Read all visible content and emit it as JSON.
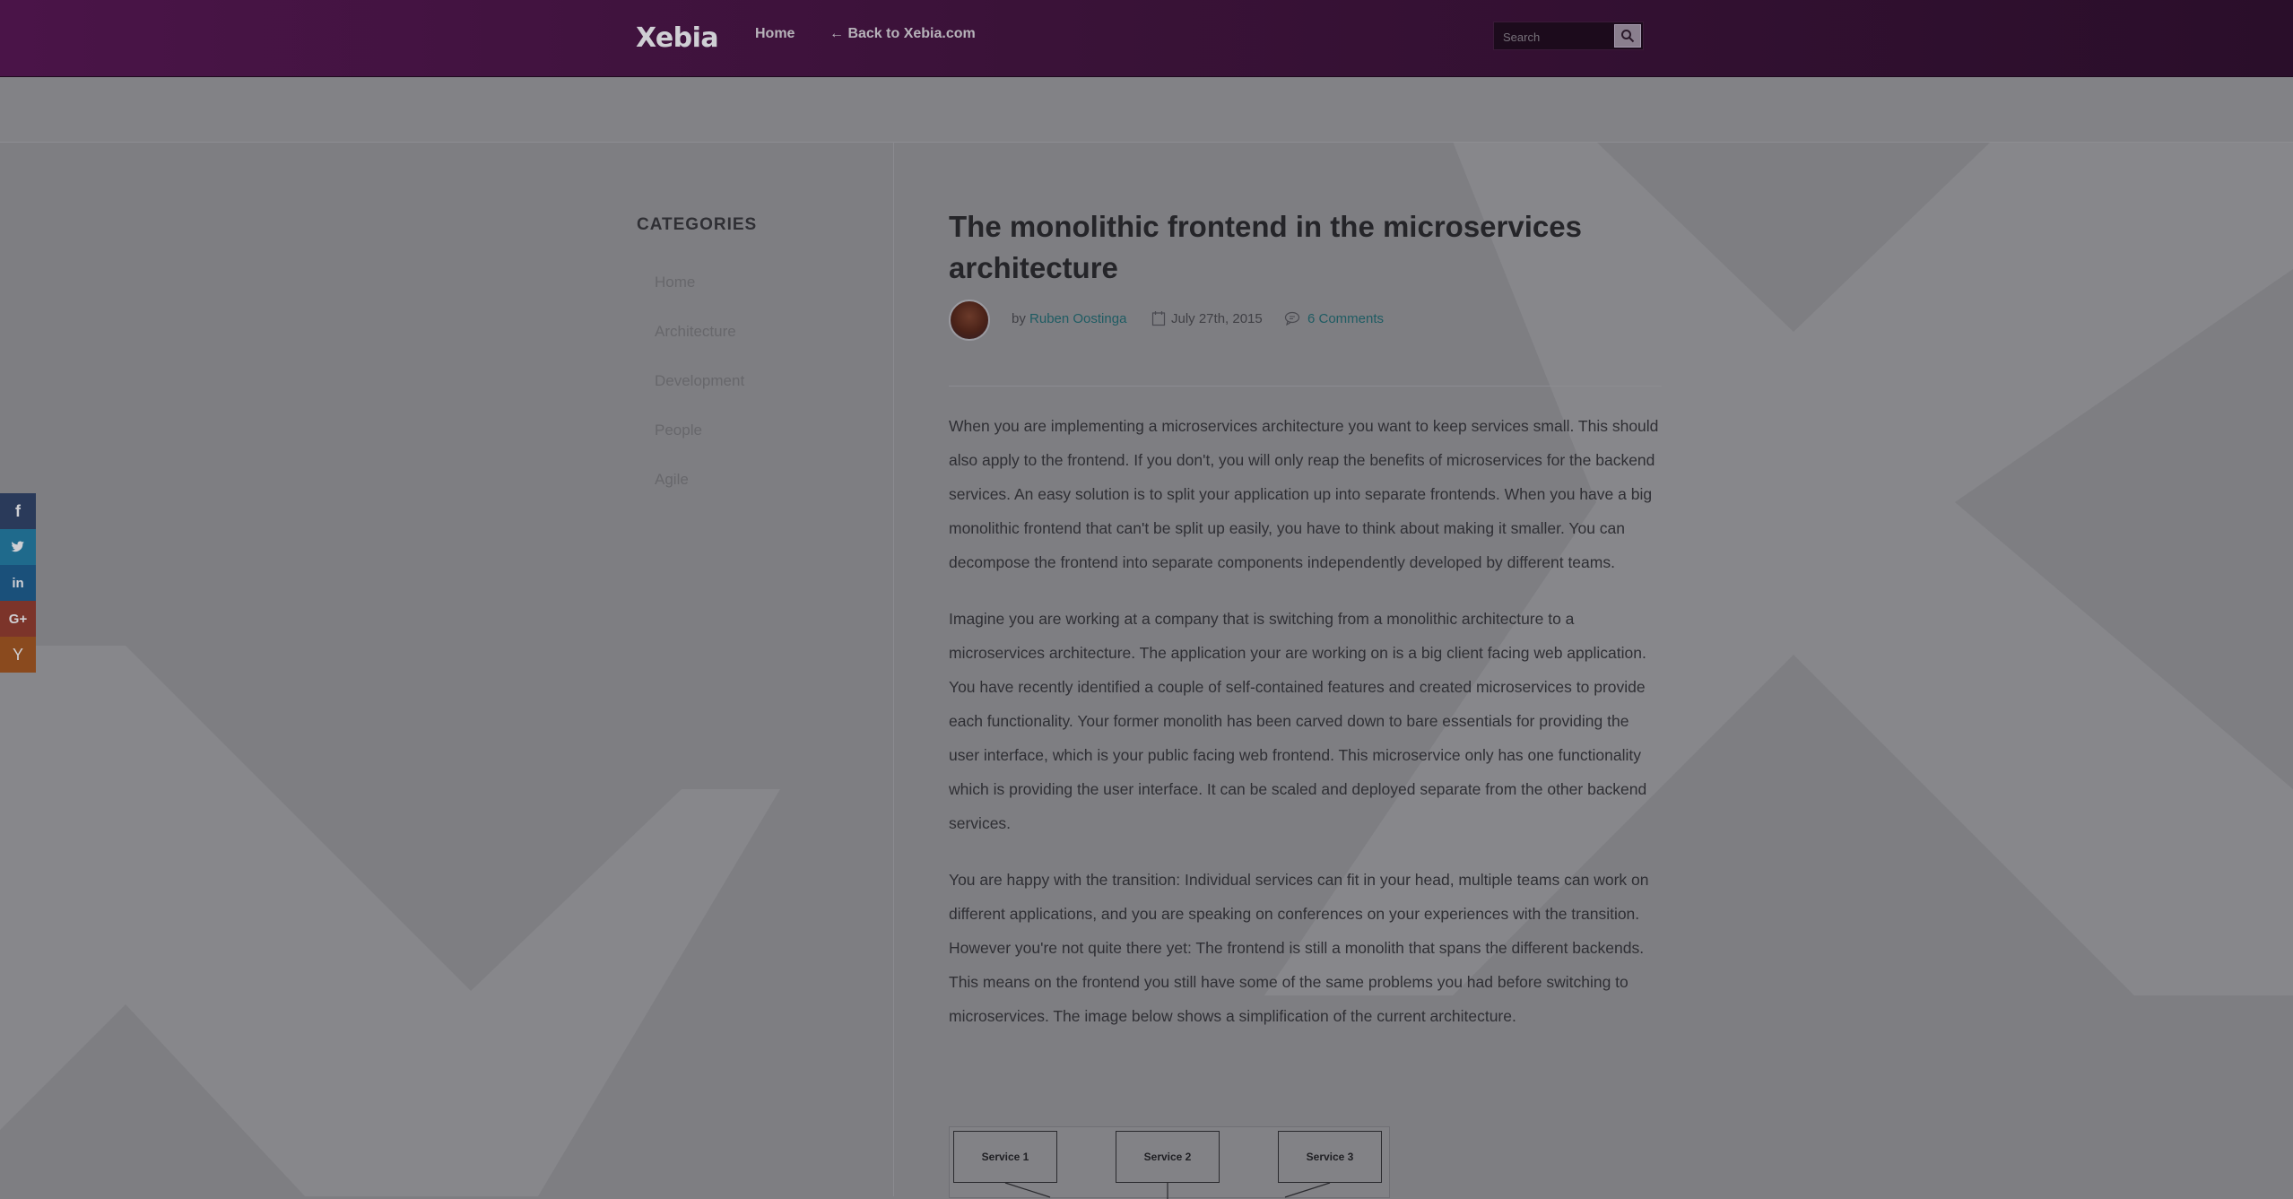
{
  "header": {
    "logo_text": "Xebia",
    "nav": {
      "home": "Home",
      "back": "← Back to Xebia.com"
    },
    "search": {
      "placeholder": "Search",
      "icon": "search-icon"
    }
  },
  "sidebar": {
    "title": "CATEGORIES",
    "items": [
      {
        "label": "Home"
      },
      {
        "label": "Architecture"
      },
      {
        "label": "Development"
      },
      {
        "label": "People"
      },
      {
        "label": "Agile"
      }
    ]
  },
  "social": {
    "buttons": [
      {
        "icon": "facebook-icon",
        "glyph": "f"
      },
      {
        "icon": "twitter-icon",
        "glyph": "t"
      },
      {
        "icon": "linkedin-icon",
        "glyph": "in"
      },
      {
        "icon": "google-plus-icon",
        "glyph": "G+"
      },
      {
        "icon": "hacker-news-icon",
        "glyph": "Y"
      }
    ]
  },
  "article": {
    "title": "The monolithic frontend in the microservices architecture",
    "meta": {
      "by": "by",
      "author": "Ruben Oostinga",
      "date": "July 27th, 2015",
      "comments": "6 Comments"
    },
    "paragraphs": [
      "When you are implementing a microservices architecture you want to keep services small. This should also apply to the frontend. If you don't, you will only reap the benefits of microservices for the backend services. An easy solution is to split your application up into separate frontends. When you have a big monolithic frontend that can't be split up easily, you have to think about making it smaller. You can decompose the frontend into separate components independently developed by different teams.",
      "Imagine you are working at a company that is switching from a monolithic architecture to a microservices architecture. The application your are working on is a big client facing web application. You have recently identified a couple of self-contained features and created microservices to provide each functionality. Your former monolith has been carved down to bare essentials for providing the user interface, which is your public facing web frontend. This microservice only has one functionality which is providing the user interface. It can be scaled and deployed separate from the other backend services.",
      "You are happy with the transition: Individual services can fit in your head, multiple teams can work on different applications, and you are speaking on conferences on your experiences with the transition. However you're not quite there yet: The frontend is still a monolith that spans the different backends. This means on the frontend you still have some of the same problems you had before switching to microservices. The image below shows a simplification of the current architecture."
    ],
    "diagram": {
      "services": [
        "Service 1",
        "Service 2",
        "Service 3"
      ]
    }
  },
  "colors": {
    "header_bg": "#3a1238",
    "link": "#1f5c63",
    "overlay_bg": "#7e7e82"
  }
}
